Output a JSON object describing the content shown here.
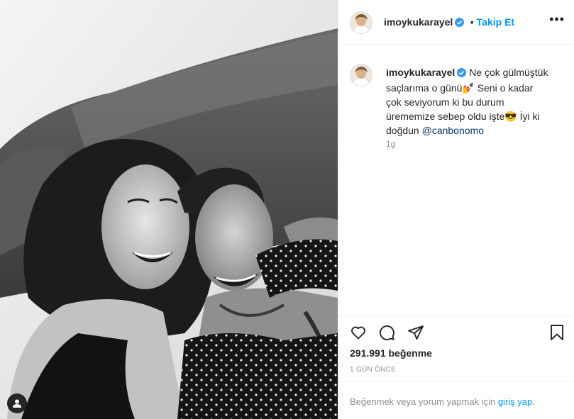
{
  "post": {
    "username": "imoykukarayel",
    "follow_label": "Takip Et",
    "separator": "•",
    "more_label": "•••",
    "caption_text": "Ne çok gülmüştük saçlarıma o günü💅 Seni o kadar çok seviyorum ki bu durum ürememize sebep oldu işte😎 İyi ki doğdun",
    "mention": "@canbonomo",
    "caption_age": "1g",
    "likes": "291.991 beğenme",
    "date": "1 GÜN ÖNCE",
    "login_prefix": "Beğenmek veya yorum yapmak için",
    "login_link": "giriş yap",
    "login_suffix": "."
  },
  "icons": {
    "verified": "verified-badge-icon",
    "like": "heart-icon",
    "comment": "comment-icon",
    "share": "share-icon",
    "save": "bookmark-icon",
    "user_tag": "user-tag-icon"
  },
  "colors": {
    "accent": "#0095f6",
    "verified": "#3897f0",
    "text": "#262626",
    "muted": "#8e8e8e",
    "border": "#efefef"
  }
}
